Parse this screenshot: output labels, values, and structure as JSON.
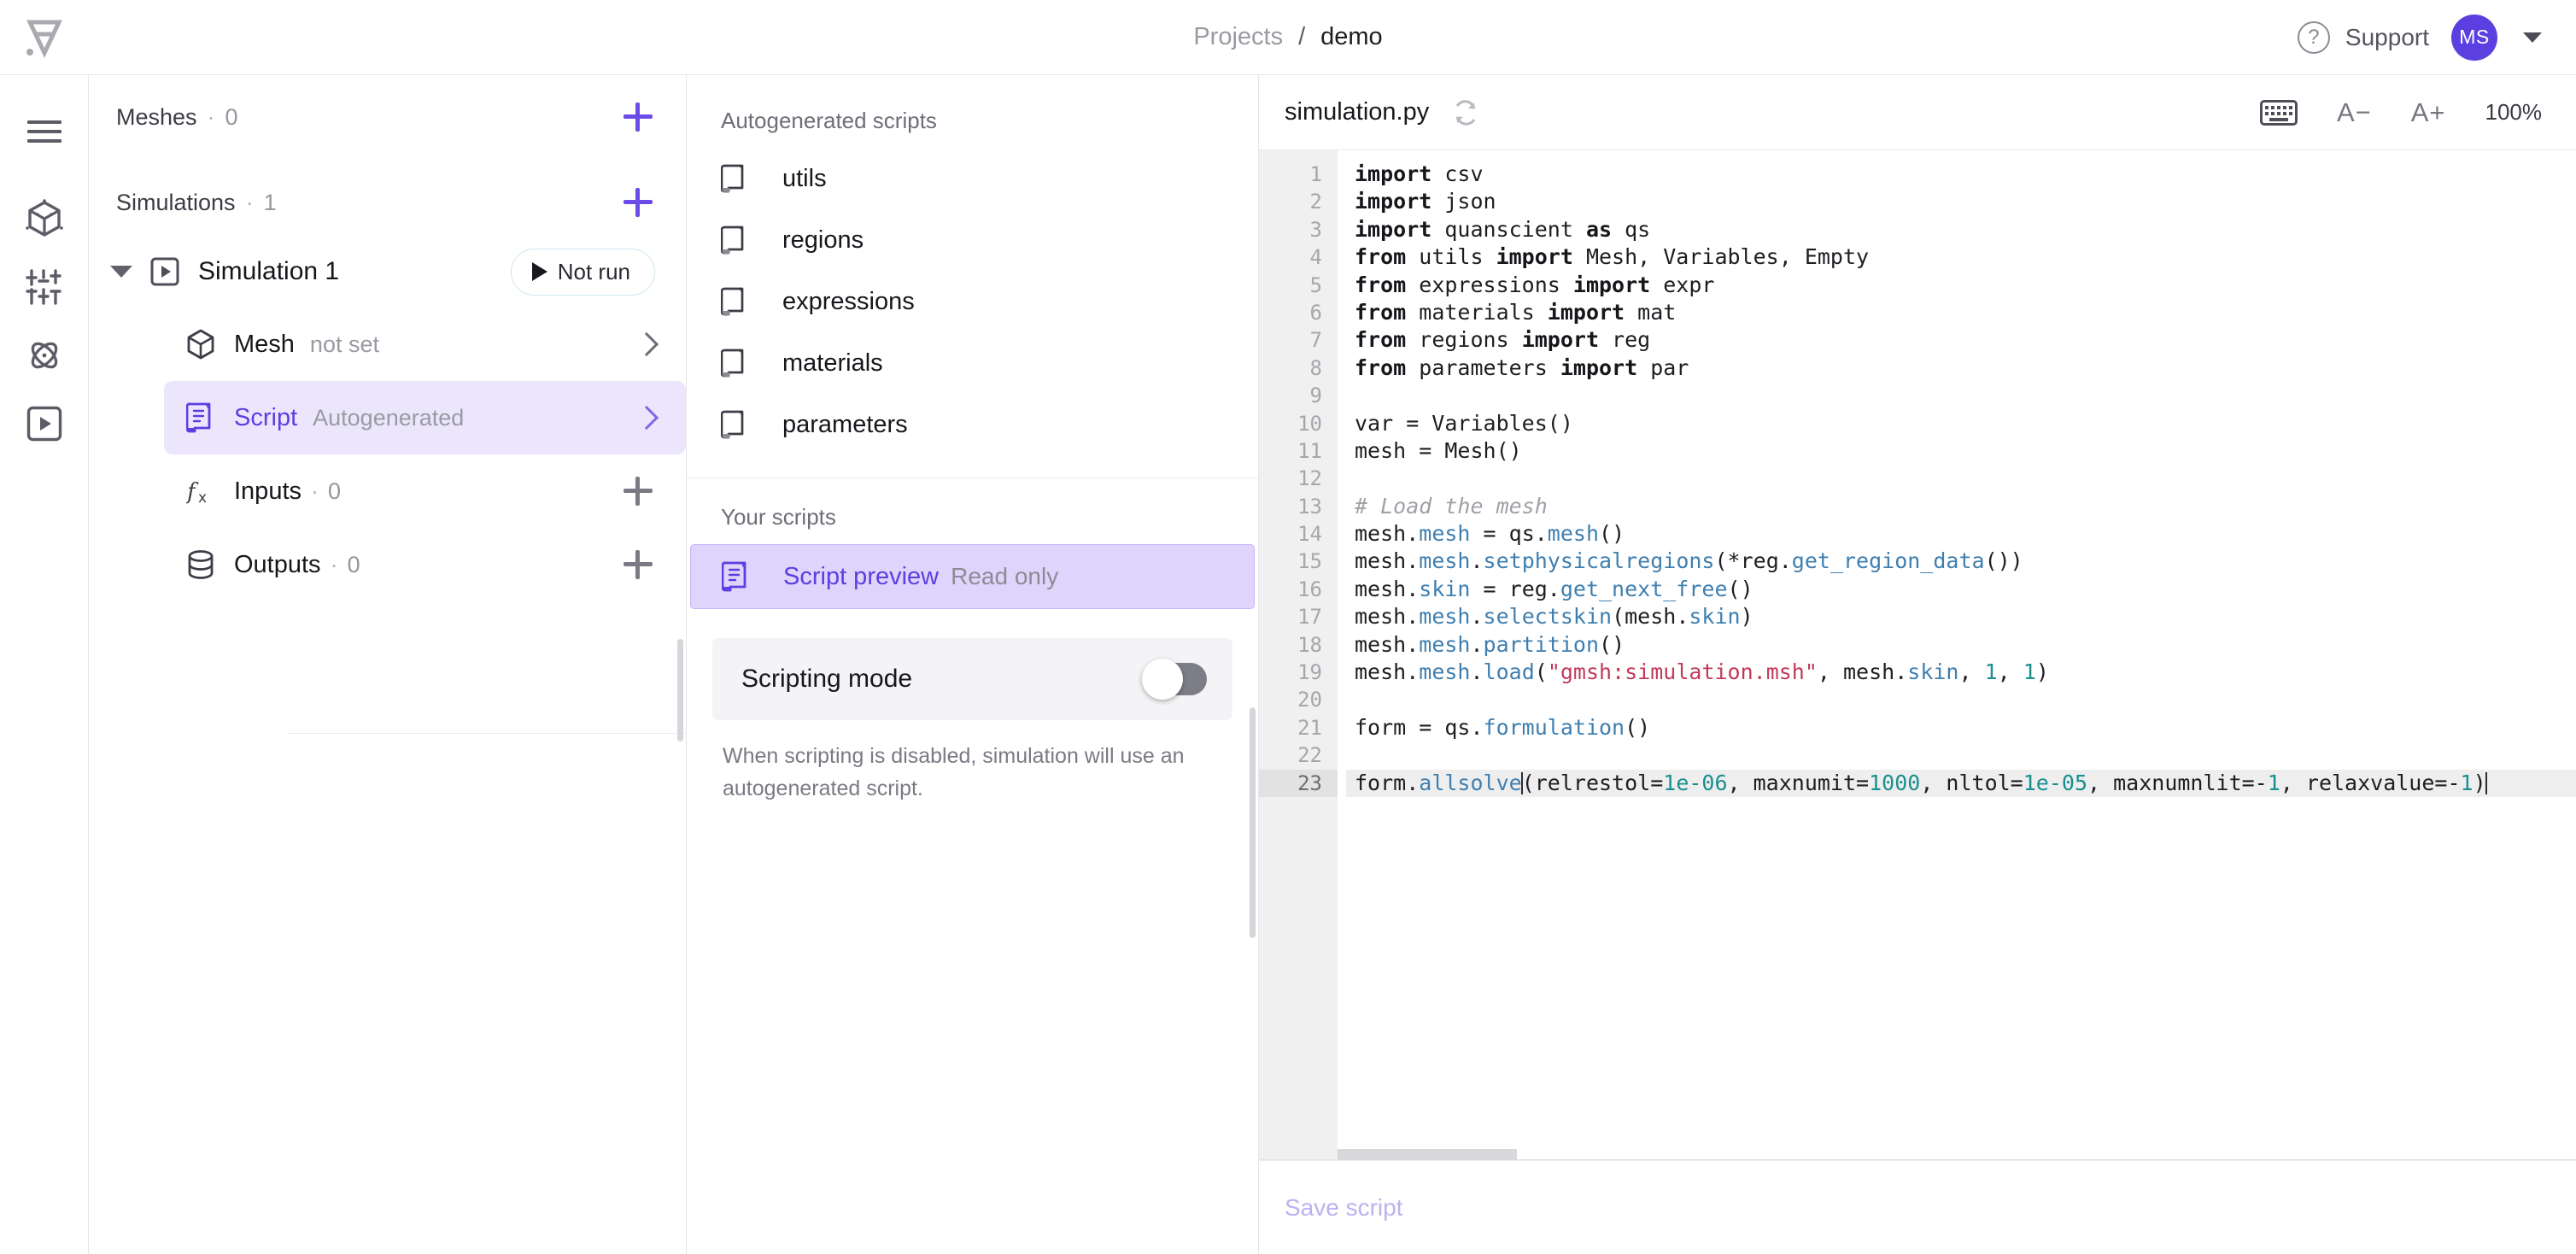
{
  "header": {
    "logo_name": "quanscient-logo",
    "breadcrumb": {
      "root": "Projects",
      "separator": "/",
      "current": "demo"
    },
    "support_label": "Support",
    "support_icon": "question-circle-icon",
    "avatar_initials": "MS",
    "chevron_icon": "chevron-down-icon"
  },
  "rail": {
    "items": [
      {
        "name": "menu-toggle",
        "icon": "hamburger-menu-icon"
      },
      {
        "name": "geometry",
        "icon": "cube-icon"
      },
      {
        "name": "parameters",
        "icon": "sliders-icon"
      },
      {
        "name": "physics",
        "icon": "atom-icon"
      },
      {
        "name": "simulations",
        "icon": "play-box-icon"
      }
    ]
  },
  "tree": {
    "meshes": {
      "label": "Meshes",
      "dot": "·",
      "count": "0",
      "add_icon": "plus-icon"
    },
    "simulations": {
      "label": "Simulations",
      "dot": "·",
      "count": "1",
      "add_icon": "plus-icon"
    },
    "simulation": {
      "name": "Simulation 1",
      "icon": "play-box-icon",
      "caret_icon": "caret-down-icon",
      "status_label": "Not run",
      "status_icon": "play-icon"
    },
    "nodes": [
      {
        "label": "Mesh",
        "sub": "not set",
        "icon": "cube-icon",
        "chevron": "chevron-right-icon"
      },
      {
        "label": "Script",
        "sub": "Autogenerated",
        "icon": "script-icon",
        "chevron": "chevron-right-icon"
      },
      {
        "label": "Inputs",
        "dot": "·",
        "count": "0",
        "icon": "fx-icon",
        "add_icon": "plus-icon"
      },
      {
        "label": "Outputs",
        "dot": "·",
        "count": "0",
        "icon": "database-icon",
        "add_icon": "plus-icon"
      }
    ]
  },
  "scripts": {
    "autogen_heading": "Autogenerated scripts",
    "autogen_files": [
      "utils",
      "regions",
      "expressions",
      "materials",
      "parameters"
    ],
    "your_heading": "Your scripts",
    "preview": {
      "label": "Script preview",
      "readonly": "Read only",
      "icon": "script-icon"
    },
    "scripting_mode": {
      "label": "Scripting mode",
      "enabled": false
    },
    "note": "When scripting is disabled, simulation will use an autogenerated script."
  },
  "editor": {
    "filename": "simulation.py",
    "sync_icon": "refresh-icon",
    "keyboard_icon": "keyboard-icon",
    "font_decrease": "A−",
    "font_increase": "A+",
    "zoom_level": "100%",
    "save_label": "Save script",
    "current_line": 23,
    "lines": [
      {
        "n": 1,
        "tokens": [
          {
            "t": "import",
            "c": "kw"
          },
          {
            "t": " csv",
            "c": ""
          }
        ]
      },
      {
        "n": 2,
        "tokens": [
          {
            "t": "import",
            "c": "kw"
          },
          {
            "t": " json",
            "c": ""
          }
        ]
      },
      {
        "n": 3,
        "tokens": [
          {
            "t": "import",
            "c": "kw"
          },
          {
            "t": " quanscient ",
            "c": ""
          },
          {
            "t": "as",
            "c": "kw"
          },
          {
            "t": " qs",
            "c": ""
          }
        ]
      },
      {
        "n": 4,
        "tokens": [
          {
            "t": "from",
            "c": "kw"
          },
          {
            "t": " utils ",
            "c": ""
          },
          {
            "t": "import",
            "c": "kw"
          },
          {
            "t": " Mesh, Variables, Empty",
            "c": ""
          }
        ]
      },
      {
        "n": 5,
        "tokens": [
          {
            "t": "from",
            "c": "kw"
          },
          {
            "t": " expressions ",
            "c": ""
          },
          {
            "t": "import",
            "c": "kw"
          },
          {
            "t": " expr",
            "c": ""
          }
        ]
      },
      {
        "n": 6,
        "tokens": [
          {
            "t": "from",
            "c": "kw"
          },
          {
            "t": " materials ",
            "c": ""
          },
          {
            "t": "import",
            "c": "kw"
          },
          {
            "t": " mat",
            "c": ""
          }
        ]
      },
      {
        "n": 7,
        "tokens": [
          {
            "t": "from",
            "c": "kw"
          },
          {
            "t": " regions ",
            "c": ""
          },
          {
            "t": "import",
            "c": "kw"
          },
          {
            "t": " reg",
            "c": ""
          }
        ]
      },
      {
        "n": 8,
        "tokens": [
          {
            "t": "from",
            "c": "kw"
          },
          {
            "t": " parameters ",
            "c": ""
          },
          {
            "t": "import",
            "c": "kw"
          },
          {
            "t": " par",
            "c": ""
          }
        ]
      },
      {
        "n": 9,
        "tokens": []
      },
      {
        "n": 10,
        "tokens": [
          {
            "t": "var = Variables()",
            "c": ""
          }
        ]
      },
      {
        "n": 11,
        "tokens": [
          {
            "t": "mesh = Mesh()",
            "c": ""
          }
        ]
      },
      {
        "n": 12,
        "tokens": []
      },
      {
        "n": 13,
        "tokens": [
          {
            "t": "# Load the mesh",
            "c": "cm"
          }
        ]
      },
      {
        "n": 14,
        "tokens": [
          {
            "t": "mesh.",
            "c": ""
          },
          {
            "t": "mesh",
            "c": "at"
          },
          {
            "t": " = qs.",
            "c": ""
          },
          {
            "t": "mesh",
            "c": "at"
          },
          {
            "t": "()",
            "c": ""
          }
        ]
      },
      {
        "n": 15,
        "tokens": [
          {
            "t": "mesh.",
            "c": ""
          },
          {
            "t": "mesh",
            "c": "at"
          },
          {
            "t": ".",
            "c": ""
          },
          {
            "t": "setphysicalregions",
            "c": "at"
          },
          {
            "t": "(*reg.",
            "c": ""
          },
          {
            "t": "get_region_data",
            "c": "at"
          },
          {
            "t": "())",
            "c": ""
          }
        ]
      },
      {
        "n": 16,
        "tokens": [
          {
            "t": "mesh.",
            "c": ""
          },
          {
            "t": "skin",
            "c": "at"
          },
          {
            "t": " = reg.",
            "c": ""
          },
          {
            "t": "get_next_free",
            "c": "at"
          },
          {
            "t": "()",
            "c": ""
          }
        ]
      },
      {
        "n": 17,
        "tokens": [
          {
            "t": "mesh.",
            "c": ""
          },
          {
            "t": "mesh",
            "c": "at"
          },
          {
            "t": ".",
            "c": ""
          },
          {
            "t": "selectskin",
            "c": "at"
          },
          {
            "t": "(mesh.",
            "c": ""
          },
          {
            "t": "skin",
            "c": "at"
          },
          {
            "t": ")",
            "c": ""
          }
        ]
      },
      {
        "n": 18,
        "tokens": [
          {
            "t": "mesh.",
            "c": ""
          },
          {
            "t": "mesh",
            "c": "at"
          },
          {
            "t": ".",
            "c": ""
          },
          {
            "t": "partition",
            "c": "at"
          },
          {
            "t": "()",
            "c": ""
          }
        ]
      },
      {
        "n": 19,
        "tokens": [
          {
            "t": "mesh.",
            "c": ""
          },
          {
            "t": "mesh",
            "c": "at"
          },
          {
            "t": ".",
            "c": ""
          },
          {
            "t": "load",
            "c": "at"
          },
          {
            "t": "(",
            "c": ""
          },
          {
            "t": "\"gmsh:simulation.msh\"",
            "c": "str"
          },
          {
            "t": ", mesh.",
            "c": ""
          },
          {
            "t": "skin",
            "c": "at"
          },
          {
            "t": ", ",
            "c": ""
          },
          {
            "t": "1",
            "c": "num"
          },
          {
            "t": ", ",
            "c": ""
          },
          {
            "t": "1",
            "c": "num"
          },
          {
            "t": ")",
            "c": ""
          }
        ]
      },
      {
        "n": 20,
        "tokens": []
      },
      {
        "n": 21,
        "tokens": [
          {
            "t": "form = qs.",
            "c": ""
          },
          {
            "t": "formulation",
            "c": "at"
          },
          {
            "t": "()",
            "c": ""
          }
        ]
      },
      {
        "n": 22,
        "tokens": []
      },
      {
        "n": 23,
        "tokens": [
          {
            "t": "form.",
            "c": ""
          },
          {
            "t": "allsolve",
            "c": "at"
          },
          {
            "t": "|CARET|",
            "c": "caret"
          },
          {
            "t": "(relrestol=",
            "c": ""
          },
          {
            "t": "1e-06",
            "c": "num"
          },
          {
            "t": ", maxnumit=",
            "c": ""
          },
          {
            "t": "1000",
            "c": "num"
          },
          {
            "t": ", nltol=",
            "c": ""
          },
          {
            "t": "1e-05",
            "c": "num"
          },
          {
            "t": ", maxnumnlit=-",
            "c": ""
          },
          {
            "t": "1",
            "c": "num"
          },
          {
            "t": ", relaxvalue=-",
            "c": ""
          },
          {
            "t": "1",
            "c": "num"
          },
          {
            "t": ")",
            "c": ""
          },
          {
            "t": "|CARET|",
            "c": "caret"
          }
        ]
      }
    ]
  },
  "colors": {
    "accent": "#5b3fe0",
    "accent_soft": "#ece6fd",
    "preview_bg": "#dfd4fb",
    "keyword": "#16161b",
    "attribute": "#3f7fb0",
    "string": "#c2395b",
    "number": "#1a8f8f",
    "comment": "#a0a0a8"
  }
}
